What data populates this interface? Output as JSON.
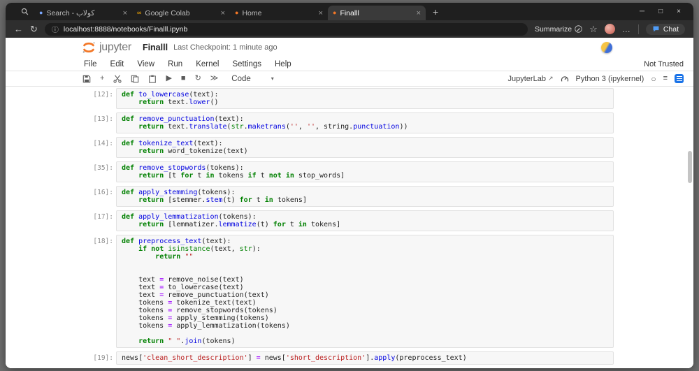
{
  "icons": {
    "back": "←",
    "refresh": "↻",
    "minimize": "─",
    "maximize": "□",
    "close": "×",
    "info": "ⓘ",
    "star": "☆",
    "dots": "…",
    "new_tab": "+",
    "plus": "+",
    "play": "▶",
    "stop": "■",
    "restart": "↻",
    "fast_forward": "≫",
    "dropdown": "▾",
    "external": "↗",
    "kernel_idle": "○",
    "list": "≡"
  },
  "colors": {
    "jupyter_orange": "#f37726",
    "colab_yellow": "#f9ab00",
    "search_blue": "#7aa7ff",
    "accent_blue": "#1a73e8"
  },
  "browser": {
    "tabs": [
      {
        "title": "Search - كولاب",
        "icon": "search",
        "active": false
      },
      {
        "title": "Google Colab",
        "icon": "colab",
        "active": false
      },
      {
        "title": "Home",
        "icon": "jupyter",
        "active": false
      },
      {
        "title": "Finalll",
        "icon": "jupyter",
        "active": true
      }
    ],
    "url": "localhost:8888/notebooks/Finalll.ipynb",
    "summarize_label": "Summarize",
    "chat_label": "Chat"
  },
  "jupyter": {
    "logo_text": "jupyter",
    "title": "Finalll",
    "checkpoint": "Last Checkpoint: 1 minute ago",
    "menus": [
      "File",
      "Edit",
      "View",
      "Run",
      "Kernel",
      "Settings",
      "Help"
    ],
    "not_trusted": "Not Trusted",
    "cell_type": "Code",
    "jupyterlab_label": "JupyterLab",
    "kernel_label": "Python 3 (ipykernel)"
  },
  "cells": [
    {
      "prompt": "[12]:",
      "lines": [
        [
          [
            "kw",
            "def"
          ],
          [
            "t",
            " "
          ],
          [
            "fn",
            "to_lowercase"
          ],
          [
            "t",
            "(text):"
          ]
        ],
        [
          [
            "t",
            "    "
          ],
          [
            "kw",
            "return"
          ],
          [
            "t",
            " text."
          ],
          [
            "fn",
            "lower"
          ],
          [
            "t",
            "()"
          ]
        ]
      ]
    },
    {
      "prompt": "[13]:",
      "lines": [
        [
          [
            "kw",
            "def"
          ],
          [
            "t",
            " "
          ],
          [
            "fn",
            "remove_punctuation"
          ],
          [
            "t",
            "(text):"
          ]
        ],
        [
          [
            "t",
            "    "
          ],
          [
            "kw",
            "return"
          ],
          [
            "t",
            " text."
          ],
          [
            "fn",
            "translate"
          ],
          [
            "t",
            "("
          ],
          [
            "bi",
            "str"
          ],
          [
            "t",
            "."
          ],
          [
            "fn",
            "maketrans"
          ],
          [
            "t",
            "("
          ],
          [
            "s",
            "''"
          ],
          [
            "t",
            ", "
          ],
          [
            "s",
            "''"
          ],
          [
            "t",
            ", string."
          ],
          [
            "fn",
            "punctuation"
          ],
          [
            "t",
            "))"
          ]
        ]
      ]
    },
    {
      "prompt": "[14]:",
      "lines": [
        [
          [
            "kw",
            "def"
          ],
          [
            "t",
            " "
          ],
          [
            "fn",
            "tokenize_text"
          ],
          [
            "t",
            "(text):"
          ]
        ],
        [
          [
            "t",
            "    "
          ],
          [
            "kw",
            "return"
          ],
          [
            "t",
            " word_tokenize(text)"
          ]
        ]
      ]
    },
    {
      "prompt": "[35]:",
      "lines": [
        [
          [
            "kw",
            "def"
          ],
          [
            "t",
            " "
          ],
          [
            "fn",
            "remove_stopwords"
          ],
          [
            "t",
            "(tokens):"
          ]
        ],
        [
          [
            "t",
            "    "
          ],
          [
            "kw",
            "return"
          ],
          [
            "t",
            " [t "
          ],
          [
            "kw",
            "for"
          ],
          [
            "t",
            " t "
          ],
          [
            "kw",
            "in"
          ],
          [
            "t",
            " tokens "
          ],
          [
            "kw",
            "if"
          ],
          [
            "t",
            " t "
          ],
          [
            "kw",
            "not"
          ],
          [
            "t",
            " "
          ],
          [
            "kw",
            "in"
          ],
          [
            "t",
            " stop_words]"
          ]
        ]
      ]
    },
    {
      "prompt": "[16]:",
      "lines": [
        [
          [
            "kw",
            "def"
          ],
          [
            "t",
            " "
          ],
          [
            "fn",
            "apply_stemming"
          ],
          [
            "t",
            "(tokens):"
          ]
        ],
        [
          [
            "t",
            "    "
          ],
          [
            "kw",
            "return"
          ],
          [
            "t",
            " [stemmer."
          ],
          [
            "fn",
            "stem"
          ],
          [
            "t",
            "(t) "
          ],
          [
            "kw",
            "for"
          ],
          [
            "t",
            " t "
          ],
          [
            "kw",
            "in"
          ],
          [
            "t",
            " tokens]"
          ]
        ]
      ]
    },
    {
      "prompt": "[17]:",
      "lines": [
        [
          [
            "kw",
            "def"
          ],
          [
            "t",
            " "
          ],
          [
            "fn",
            "apply_lemmatization"
          ],
          [
            "t",
            "(tokens):"
          ]
        ],
        [
          [
            "t",
            "    "
          ],
          [
            "kw",
            "return"
          ],
          [
            "t",
            " [lemmatizer."
          ],
          [
            "fn",
            "lemmatize"
          ],
          [
            "t",
            "(t) "
          ],
          [
            "kw",
            "for"
          ],
          [
            "t",
            " t "
          ],
          [
            "kw",
            "in"
          ],
          [
            "t",
            " tokens]"
          ]
        ]
      ]
    },
    {
      "prompt": "[18]:",
      "lines": [
        [
          [
            "kw",
            "def"
          ],
          [
            "t",
            " "
          ],
          [
            "fn",
            "preprocess_text"
          ],
          [
            "t",
            "(text):"
          ]
        ],
        [
          [
            "t",
            "    "
          ],
          [
            "kw",
            "if"
          ],
          [
            "t",
            " "
          ],
          [
            "kw",
            "not"
          ],
          [
            "t",
            " "
          ],
          [
            "bi",
            "isinstance"
          ],
          [
            "t",
            "(text, "
          ],
          [
            "bi",
            "str"
          ],
          [
            "t",
            "):"
          ]
        ],
        [
          [
            "t",
            "        "
          ],
          [
            "kw",
            "return"
          ],
          [
            "t",
            " "
          ],
          [
            "s",
            "\"\""
          ]
        ],
        [],
        [],
        [
          [
            "t",
            "    text "
          ],
          [
            "op",
            "="
          ],
          [
            "t",
            " remove_noise(text)"
          ]
        ],
        [
          [
            "t",
            "    text "
          ],
          [
            "op",
            "="
          ],
          [
            "t",
            " to_lowercase(text)"
          ]
        ],
        [
          [
            "t",
            "    text "
          ],
          [
            "op",
            "="
          ],
          [
            "t",
            " remove_punctuation(text)"
          ]
        ],
        [
          [
            "t",
            "    tokens "
          ],
          [
            "op",
            "="
          ],
          [
            "t",
            " tokenize_text(text)"
          ]
        ],
        [
          [
            "t",
            "    tokens "
          ],
          [
            "op",
            "="
          ],
          [
            "t",
            " remove_stopwords(tokens)"
          ]
        ],
        [
          [
            "t",
            "    tokens "
          ],
          [
            "op",
            "="
          ],
          [
            "t",
            " apply_stemming(tokens)"
          ]
        ],
        [
          [
            "t",
            "    tokens "
          ],
          [
            "op",
            "="
          ],
          [
            "t",
            " apply_lemmatization(tokens)"
          ]
        ],
        [],
        [
          [
            "t",
            "    "
          ],
          [
            "kw",
            "return"
          ],
          [
            "t",
            " "
          ],
          [
            "s",
            "\" \""
          ],
          [
            "t",
            "."
          ],
          [
            "fn",
            "join"
          ],
          [
            "t",
            "(tokens)"
          ]
        ]
      ]
    },
    {
      "prompt": "[19]:",
      "lines": [
        [
          [
            "t",
            "news["
          ],
          [
            "s",
            "'clean_short_description'"
          ],
          [
            "t",
            "] "
          ],
          [
            "op",
            "="
          ],
          [
            "t",
            " news["
          ],
          [
            "s",
            "'short_description'"
          ],
          [
            "t",
            "]."
          ],
          [
            "fn",
            "apply"
          ],
          [
            "t",
            "(preprocess_text)"
          ]
        ]
      ]
    }
  ]
}
